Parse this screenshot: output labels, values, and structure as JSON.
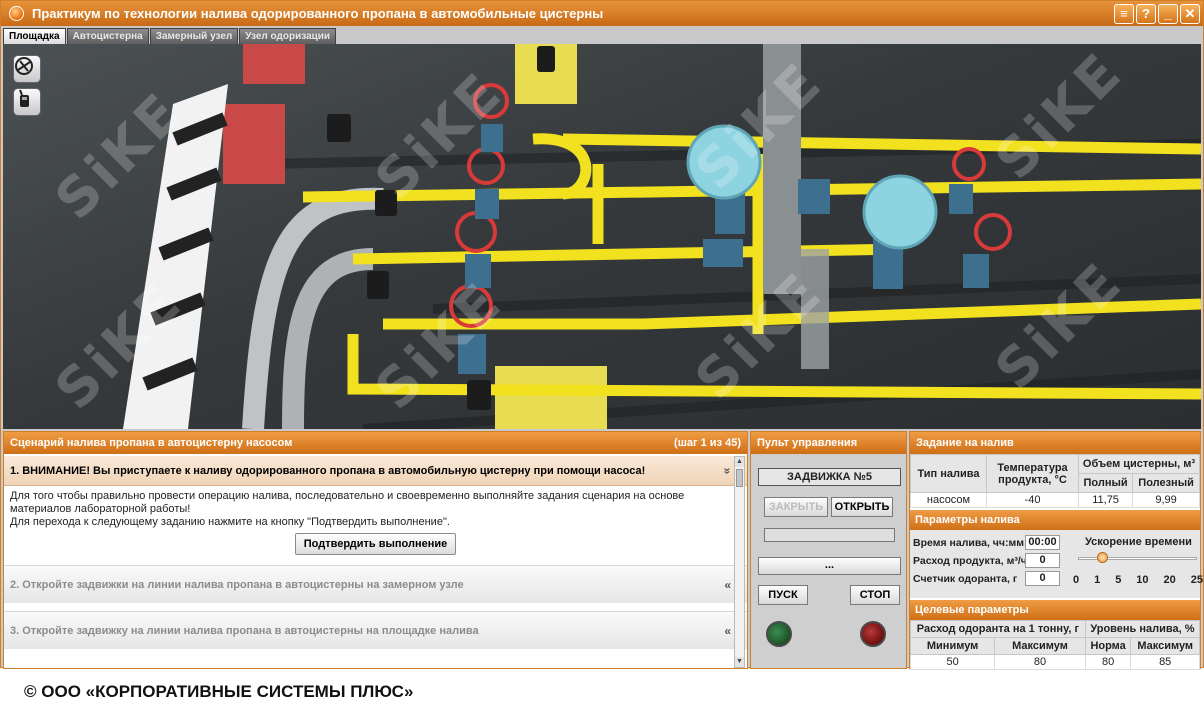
{
  "window": {
    "title": "Практикум по технологии налива одорированного пропана в автомобильные цистерны",
    "buttons": [
      "menu-icon",
      "help-icon",
      "minimize-icon",
      "close-icon"
    ],
    "button_glyphs": {
      "help": "?",
      "minimize": "_",
      "close": "✕",
      "menu": "≡"
    }
  },
  "tabs": [
    {
      "label": "Площадка",
      "active": true
    },
    {
      "label": "Автоцистерна",
      "active": false
    },
    {
      "label": "Замерный узел",
      "active": false
    },
    {
      "label": "Узел одоризации",
      "active": false
    }
  ],
  "scene": {
    "tools": [
      "grounding-tool-icon",
      "radio-icon"
    ],
    "watermark": "SiKE"
  },
  "scenario": {
    "title": "Сценарий налива пропана в автоцистерну насосом",
    "step_counter": "(шаг 1 из 45)",
    "steps": [
      {
        "label": "1.  ВНИМАНИЕ! Вы приступаете к наливу одорированного пропана в автомобильную цистерну при помощи насоса!",
        "expanded": true,
        "body_line1": "Для того чтобы правильно провести операцию налива, последовательно и своевременно выполняйте задания сценария на основе материалов лабораторной работы!",
        "body_line2": "Для перехода к следующему заданию нажмите на кнопку \"Подтвердить выполнение\".",
        "confirm_label": "Подтвердить выполнение"
      },
      {
        "label": "2.  Откройте задвижки на линии налива пропана в автоцистерны на замерном узле",
        "expanded": false
      },
      {
        "label": "3.  Откройте задвижку на линии налива пропана в автоцистерны на площадке налива",
        "expanded": false
      }
    ],
    "arrow_expanded": "»",
    "arrow_collapsed": "«"
  },
  "control": {
    "title": "Пульт управления",
    "selected": "ЗАДВИЖКА №5",
    "close_label": "ЗАКРЫТЬ",
    "open_label": "ОТКРЫТЬ",
    "more_label": "...",
    "start_label": "ПУСК",
    "stop_label": "СТОП",
    "lamp_green": "#1f5d2c",
    "lamp_red": "#7a1414"
  },
  "task": {
    "title": "Задание на налив",
    "headers": {
      "type": "Тип налива",
      "temperature": "Температура продукта, °С",
      "volume": "Объем цистерны, м³",
      "full": "Полный",
      "useful": "Полезный"
    },
    "row": {
      "type": "насосом",
      "temperature": "-40",
      "full": "11,75",
      "useful": "9,99"
    }
  },
  "params": {
    "title": "Параметры налива",
    "time_label": "Время налива, чч:мм",
    "time_value": "00:00",
    "flow_label": "Расход продукта, м³/ч",
    "flow_value": "0",
    "counter_label": "Счетчик одоранта, г",
    "counter_value": "0",
    "speed_title": "Ускорение времени",
    "speed_ticks": [
      "0",
      "1",
      "5",
      "10",
      "20",
      "25"
    ],
    "speed_value": "1"
  },
  "target": {
    "title": "Целевые параметры",
    "odorant_header": "Расход одоранта на 1 тонну, г",
    "level_header": "Уровень налива, %",
    "min_label": "Минимум",
    "max_label": "Максимум",
    "norm_label": "Норма",
    "max2_label": "Максимум",
    "min_value": "50",
    "max_value": "80",
    "norm_value": "80",
    "max2_value": "85"
  },
  "footer": {
    "copyright": "© ООО «КОРПОРАТИВНЫЕ СИСТЕМЫ ПЛЮС»"
  },
  "colors": {
    "accent": "#d27f2a",
    "pipe": "#f2e11e",
    "valve_wheel": "#d83a3a",
    "valve_body": "#3d6f8e"
  }
}
